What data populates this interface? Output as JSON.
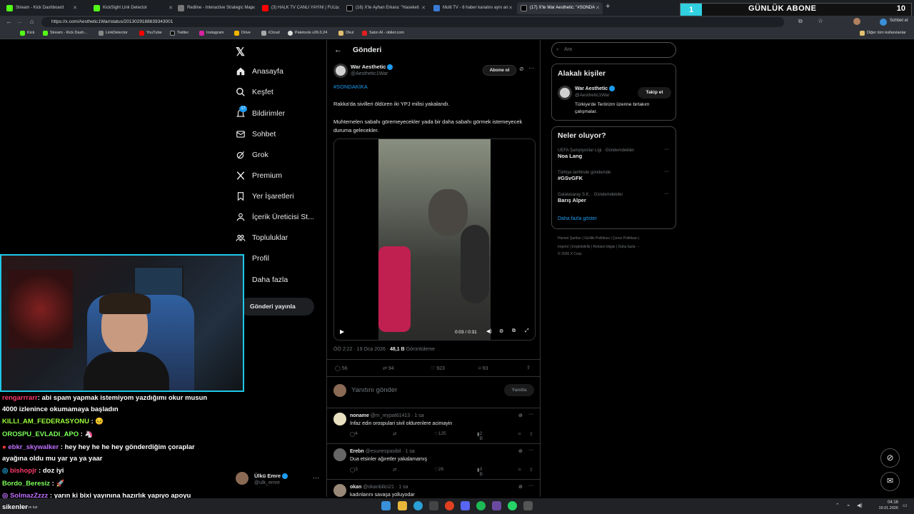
{
  "browser": {
    "tabs": [
      {
        "label": "Stream - Kick Dashboard",
        "color": "#53fc18"
      },
      {
        "label": "KickSight Link Detector",
        "color": "#53fc18"
      },
      {
        "label": "Redline - Interactive Strategic Map",
        "color": "#888888"
      },
      {
        "label": "(3) HALK TV CANLI YAYINI | FULL",
        "color": "#ff0000"
      },
      {
        "label": "(16) X'te Ayhan Erkara: \"Haseketi",
        "color": "#ffffff"
      },
      {
        "label": "Multi TV - 6 haber kanalını aynı an",
        "color": "#3a7bd5"
      },
      {
        "label": "(17) X'te War Aesthetic: \"#SONDA",
        "color": "#ffffff"
      }
    ],
    "url": "https://x.com/Aesthetic1War/status/2013029188639343001",
    "profile_label": "Sohbet et",
    "bookmarks": [
      "Kick",
      "Stream - Kick Dash...",
      "LinkDetector",
      "YouTube",
      "Twitter",
      "Instagram",
      "Drive",
      "iCloud",
      "Paletools v26.0.24",
      "Okul",
      "Satın Al - obilet.com"
    ],
    "bookmarks_other": "Diğer tüm kullanılanlar"
  },
  "overlay": {
    "num_left": "1",
    "title": "GÜNLÜK ABONE",
    "num_right": "10"
  },
  "nav": {
    "items": [
      "Anasayfa",
      "Keşfet",
      "Bildirimler",
      "Sohbet",
      "Grok",
      "Premium",
      "Yer İşaretleri",
      "İçerik Üreticisi St...",
      "Topluluklar",
      "Profil",
      "Daha fazla"
    ],
    "notif_badge": "17",
    "post_button": "Gönderi yayınla",
    "user_name": "Ülkü Emre",
    "user_handle": "@ulk_emre"
  },
  "post": {
    "header": "Gönderi",
    "author": "War Aesthetic",
    "handle": "@Aesthetic1War",
    "subscribe": "Abone ol",
    "hashtag": "#SONDAKİKA",
    "text1": "Rakka'da sivilleri öldüren iki YPJ milisi yakalandı.",
    "text2": "Muhtemelen sabahı göremeyecekler yada bir daha sabahı görmek istemeyecek duruma gelecekler.",
    "video_time": "0:03 / 0:31",
    "timestamp": "ÖÖ 2:22 · 19 Oca 2026 · ",
    "views": "48,1 B",
    "views_label": "Görüntüleme",
    "replies": "56",
    "reposts": "94",
    "likes": "923",
    "bookmarks": "93",
    "reply_placeholder": "Yanıtını gönder",
    "reply_button": "Yanıtla"
  },
  "replies": [
    {
      "name": "noname",
      "handle": "@m_mypat61413 · 1 sa",
      "text": "İnfaz edin orospulari sivil oldurenlere acimayin",
      "r": "4",
      "l": "125",
      "v": "2 B"
    },
    {
      "name": "Erebn",
      "handle": "@esunespasibil · 1 sa",
      "text": "Dua etsinler ağıretler yakalamamış",
      "r": "3",
      "l": "26",
      "v": "3 B"
    },
    {
      "name": "okan",
      "handle": "@okanbilici21 · 1 sa",
      "text": "kadınlarını savaşa yolluyodar"
    }
  ],
  "right": {
    "search_placeholder": "Ara",
    "people_title": "Alakalı kişiler",
    "person_name": "War Aesthetic",
    "person_handle": "@Aesthetic1War",
    "person_bio": "Türkiye'de Terörizm üzerine birtakım çalışmalar.",
    "follow_button": "Takip et",
    "trends_title": "Neler oluyor?",
    "trends": [
      {
        "cat": "UEFA Şampiyonlar Ligi · Gündemdekiler",
        "name": "Noa Lang"
      },
      {
        "cat": "Türkiye tarihinde gündemde",
        "name": "#GSvGFK"
      },
      {
        "cat": "Galatasaray S.K. · Gündemdekiler",
        "name": "Barış Alper"
      }
    ],
    "show_more": "Daha fazla göster",
    "footer1": "Hizmet Şartları  |  Gizlilik Politikası  |  Çerez Politikası  |",
    "footer2": "Imprint  |  Erişilebilirlik  |  Reklam bilgisi  |  Daha fazla ···",
    "footer3": "© 2026 X Corp."
  },
  "chat": [
    {
      "user": "rengarrrarr",
      "color": "#ff3b6b",
      "msg": ": abi spam yapmak istemiyom yazdığımı okur musun"
    },
    {
      "user": "",
      "color": "#ffffff",
      "msg": "4000 izlenince okumamaya başladın"
    },
    {
      "user": "KILLI_AM_FEDERASYONU",
      "color": "#9bff3b",
      "msg": " : "
    },
    {
      "user": "OROSPU_EVLADI_APO",
      "color": "#7dff5a",
      "msg": " : "
    },
    {
      "user": "ebkr_skywalker",
      "color": "#c070ff",
      "msg": " : hey hey he he hey gönderdiğim çoraplar"
    },
    {
      "user": "",
      "color": "#ffffff",
      "msg": "ayağına oldu mu yar ya ya yaar"
    },
    {
      "user": "bishopjr",
      "color": "#ff3b6b",
      "msg": " : doz iyi"
    },
    {
      "user": "Bordo_Beresiz",
      "color": "#7dff5a",
      "msg": " : "
    },
    {
      "user": "SolmazZzzz",
      "color": "#c070ff",
      "msg": " : yarın ki bixi yayınına hazırlık yapıyo apoyu"
    },
    {
      "user": "",
      "color": "#ffffff",
      "msg": "sikenler"
    }
  ],
  "taskbar": {
    "time": "04:16",
    "date": "19.01.2026",
    "weather": "Kar ve kar"
  }
}
